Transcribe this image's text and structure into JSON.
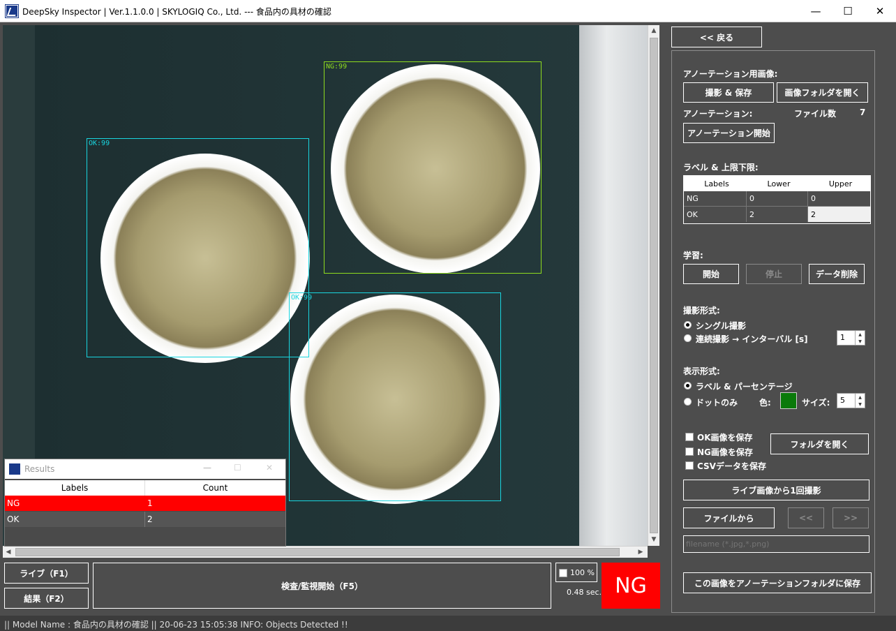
{
  "window": {
    "title": "DeepSky Inspector | Ver.1.1.0.0 | SKYLOGIQ Co., Ltd. --- 食品内の具材の確認",
    "minimize": "—",
    "maximize": "☐",
    "close": "✕"
  },
  "image": {
    "detections": [
      {
        "label": "NG:99"
      },
      {
        "label": "OK:99"
      },
      {
        "label": "OK:99"
      }
    ]
  },
  "results_window": {
    "title": "Results",
    "columns": [
      "Labels",
      "Count"
    ],
    "rows": [
      {
        "label": "NG",
        "count": "1"
      },
      {
        "label": "OK",
        "count": "2"
      }
    ],
    "highlight_color": "#ff0000"
  },
  "bottom": {
    "live_button": "ライブ（F1）",
    "result_button": "結果（F2）",
    "inspect_button": "検査/監視開始（F5）",
    "zoom_checkbox": "100 %",
    "elapsed": "0.48 sec.",
    "verdict": "NG",
    "verdict_color": "#ff0000"
  },
  "right": {
    "back_button": "<< 戻る",
    "annotation_image_label": "アノーテーション用画像:",
    "capture_save_button": "撮影 & 保存",
    "open_image_folder_button": "画像フォルダを開く",
    "annotation_label": "アノーテーション:",
    "file_count_label": "ファイル数",
    "file_count": "7",
    "start_annotation_button": "アノーテーション開始",
    "label_limits_title": "ラベル & 上限下限:",
    "limits_table": {
      "columns": [
        "Labels",
        "Lower",
        "Upper"
      ],
      "rows": [
        {
          "label": "NG",
          "lower": "0",
          "upper": "0"
        },
        {
          "label": "OK",
          "lower": "2",
          "upper": "2"
        }
      ]
    },
    "training_label": "学習:",
    "train_start_button": "開始",
    "train_stop_button": "停止",
    "delete_data_button": "データ削除",
    "capture_mode_label": "撮影形式:",
    "single_capture": "シングル撮影",
    "continuous_capture": "連続撮影 → インターバル [s]",
    "interval_value": "1",
    "display_mode_label": "表示形式:",
    "label_percentage": "ラベル & パーセンテージ",
    "dots_only": "ドットのみ",
    "color_label": "色:",
    "dot_color": "#0a7a0a",
    "size_label": "サイズ:",
    "size_value": "5",
    "save_ok_images": "OK画像を保存",
    "save_ng_images": "NG画像を保存",
    "save_csv": "CSVデータを保存",
    "open_folder_button": "フォルダを開く",
    "capture_once_button": "ライブ画像から1回撮影",
    "from_file_button": "ファイルから",
    "prev_button": "<<",
    "next_button": ">>",
    "filename_placeholder": "filename (*.jpg,*.png)",
    "save_to_annotation_button": "この画像をアノーテーションフォルダに保存"
  },
  "status": {
    "text": "|| Model Name : 食品内の具材の確認 ||    20-06-23 15:05:38   INFO:   Objects Detected !!"
  }
}
